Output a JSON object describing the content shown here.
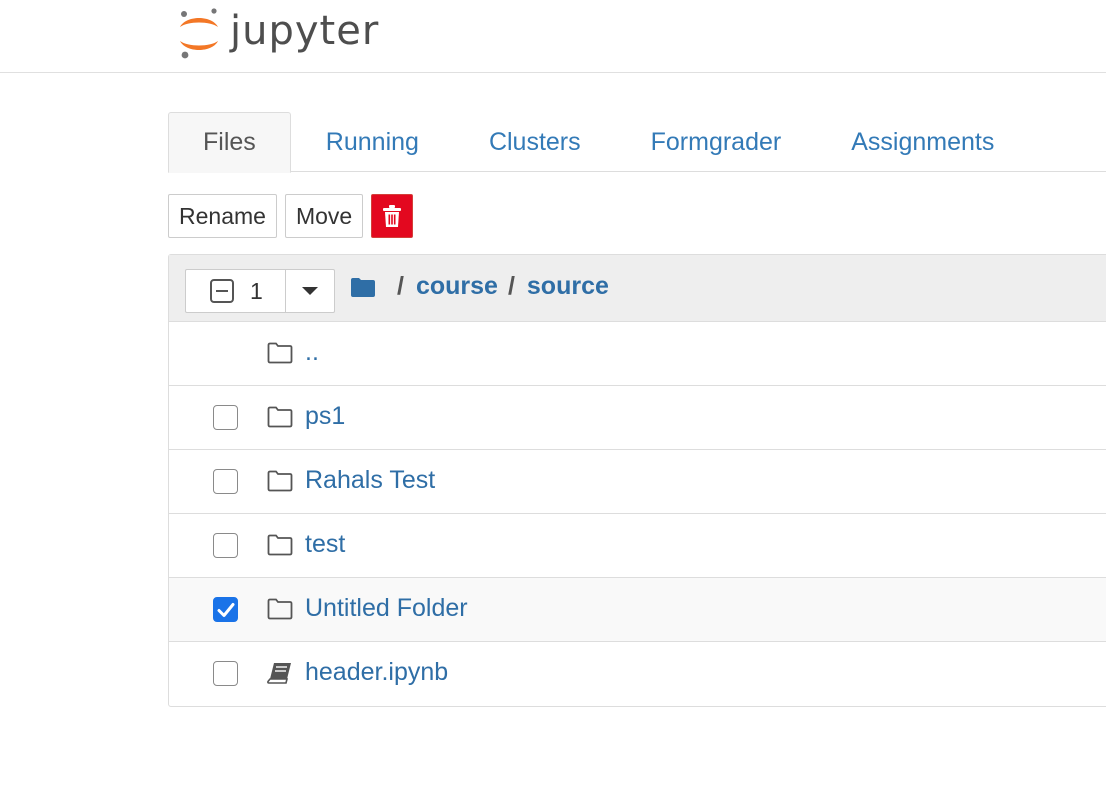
{
  "app": {
    "name": "jupyter"
  },
  "tabs": [
    {
      "label": "Files",
      "active": true
    },
    {
      "label": "Running",
      "active": false
    },
    {
      "label": "Clusters",
      "active": false
    },
    {
      "label": "Formgrader",
      "active": false
    },
    {
      "label": "Assignments",
      "active": false
    }
  ],
  "toolbar": {
    "rename_label": "Rename",
    "move_label": "Move",
    "delete_icon": "trash-icon"
  },
  "list_header": {
    "selected_count": "1",
    "breadcrumb": [
      {
        "label": "/"
      },
      {
        "label": "course"
      },
      {
        "label": "/"
      },
      {
        "label": "source"
      }
    ]
  },
  "items": [
    {
      "name": "..",
      "type": "folder",
      "checkable": false,
      "checked": false
    },
    {
      "name": "ps1",
      "type": "folder",
      "checkable": true,
      "checked": false
    },
    {
      "name": "Rahals Test",
      "type": "folder",
      "checkable": true,
      "checked": false
    },
    {
      "name": "test",
      "type": "folder",
      "checkable": true,
      "checked": false
    },
    {
      "name": "Untitled Folder",
      "type": "folder",
      "checkable": true,
      "checked": true
    },
    {
      "name": "header.ipynb",
      "type": "notebook",
      "checkable": true,
      "checked": false
    }
  ],
  "colors": {
    "link": "#2f6ea6",
    "danger": "#e3081f",
    "checkbox_checked": "#1a73e8",
    "logo_orange": "#f37726",
    "logo_gray": "#767677"
  }
}
